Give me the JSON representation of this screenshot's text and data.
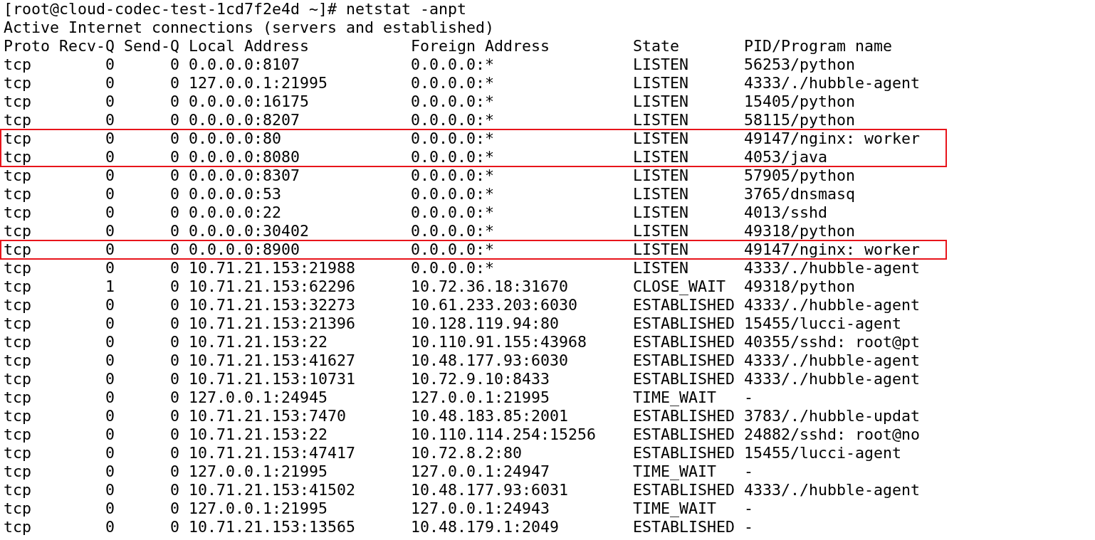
{
  "prompt": "[root@cloud-codec-test-1cd7f2e4d ~]# netstat -anpt",
  "summary": "Active Internet connections (servers and established)",
  "columns": [
    "Proto",
    "Recv-Q",
    "Send-Q",
    "Local Address",
    "Foreign Address",
    "State",
    "PID/Program name"
  ],
  "rows": [
    {
      "cells": [
        "tcp",
        "0",
        "0",
        "0.0.0.0:8107",
        "0.0.0.0:*",
        "LISTEN",
        "56253/python"
      ],
      "highlighted": false
    },
    {
      "cells": [
        "tcp",
        "0",
        "0",
        "127.0.0.1:21995",
        "0.0.0.0:*",
        "LISTEN",
        "4333/./hubble-agent"
      ],
      "highlighted": false
    },
    {
      "cells": [
        "tcp",
        "0",
        "0",
        "0.0.0.0:16175",
        "0.0.0.0:*",
        "LISTEN",
        "15405/python"
      ],
      "highlighted": false
    },
    {
      "cells": [
        "tcp",
        "0",
        "0",
        "0.0.0.0:8207",
        "0.0.0.0:*",
        "LISTEN",
        "58115/python"
      ],
      "highlighted": false
    },
    {
      "cells": [
        "tcp",
        "0",
        "0",
        "0.0.0.0:80",
        "0.0.0.0:*",
        "LISTEN",
        "49147/nginx: worker"
      ],
      "highlighted": true
    },
    {
      "cells": [
        "tcp",
        "0",
        "0",
        "0.0.0.0:8080",
        "0.0.0.0:*",
        "LISTEN",
        "4053/java"
      ],
      "highlighted": true
    },
    {
      "cells": [
        "tcp",
        "0",
        "0",
        "0.0.0.0:8307",
        "0.0.0.0:*",
        "LISTEN",
        "57905/python"
      ],
      "highlighted": false
    },
    {
      "cells": [
        "tcp",
        "0",
        "0",
        "0.0.0.0:53",
        "0.0.0.0:*",
        "LISTEN",
        "3765/dnsmasq"
      ],
      "highlighted": false
    },
    {
      "cells": [
        "tcp",
        "0",
        "0",
        "0.0.0.0:22",
        "0.0.0.0:*",
        "LISTEN",
        "4013/sshd"
      ],
      "highlighted": false
    },
    {
      "cells": [
        "tcp",
        "0",
        "0",
        "0.0.0.0:30402",
        "0.0.0.0:*",
        "LISTEN",
        "49318/python"
      ],
      "highlighted": false
    },
    {
      "cells": [
        "tcp",
        "0",
        "0",
        "0.0.0.0:8900",
        "0.0.0.0:*",
        "LISTEN",
        "49147/nginx: worker"
      ],
      "highlighted": true
    },
    {
      "cells": [
        "tcp",
        "0",
        "0",
        "10.71.21.153:21988",
        "0.0.0.0:*",
        "LISTEN",
        "4333/./hubble-agent"
      ],
      "highlighted": false
    },
    {
      "cells": [
        "tcp",
        "1",
        "0",
        "10.71.21.153:62296",
        "10.72.36.18:31670",
        "CLOSE_WAIT",
        "49318/python"
      ],
      "highlighted": false
    },
    {
      "cells": [
        "tcp",
        "0",
        "0",
        "10.71.21.153:32273",
        "10.61.233.203:6030",
        "ESTABLISHED",
        "4333/./hubble-agent"
      ],
      "highlighted": false
    },
    {
      "cells": [
        "tcp",
        "0",
        "0",
        "10.71.21.153:21396",
        "10.128.119.94:80",
        "ESTABLISHED",
        "15455/lucci-agent"
      ],
      "highlighted": false
    },
    {
      "cells": [
        "tcp",
        "0",
        "0",
        "10.71.21.153:22",
        "10.110.91.155:43968",
        "ESTABLISHED",
        "40355/sshd: root@pt"
      ],
      "highlighted": false
    },
    {
      "cells": [
        "tcp",
        "0",
        "0",
        "10.71.21.153:41627",
        "10.48.177.93:6030",
        "ESTABLISHED",
        "4333/./hubble-agent"
      ],
      "highlighted": false
    },
    {
      "cells": [
        "tcp",
        "0",
        "0",
        "10.71.21.153:10731",
        "10.72.9.10:8433",
        "ESTABLISHED",
        "4333/./hubble-agent"
      ],
      "highlighted": false
    },
    {
      "cells": [
        "tcp",
        "0",
        "0",
        "127.0.0.1:24945",
        "127.0.0.1:21995",
        "TIME_WAIT",
        "-"
      ],
      "highlighted": false
    },
    {
      "cells": [
        "tcp",
        "0",
        "0",
        "10.71.21.153:7470",
        "10.48.183.85:2001",
        "ESTABLISHED",
        "3783/./hubble-updat"
      ],
      "highlighted": false
    },
    {
      "cells": [
        "tcp",
        "0",
        "0",
        "10.71.21.153:22",
        "10.110.114.254:15256",
        "ESTABLISHED",
        "24882/sshd: root@no"
      ],
      "highlighted": false
    },
    {
      "cells": [
        "tcp",
        "0",
        "0",
        "10.71.21.153:47417",
        "10.72.8.2:80",
        "ESTABLISHED",
        "15455/lucci-agent"
      ],
      "highlighted": false
    },
    {
      "cells": [
        "tcp",
        "0",
        "0",
        "127.0.0.1:21995",
        "127.0.0.1:24947",
        "TIME_WAIT",
        "-"
      ],
      "highlighted": false
    },
    {
      "cells": [
        "tcp",
        "0",
        "0",
        "10.71.21.153:41502",
        "10.48.177.93:6031",
        "ESTABLISHED",
        "4333/./hubble-agent"
      ],
      "highlighted": false
    },
    {
      "cells": [
        "tcp",
        "0",
        "0",
        "127.0.0.1:21995",
        "127.0.0.1:24943",
        "TIME_WAIT",
        "-"
      ],
      "highlighted": false
    },
    {
      "cells": [
        "tcp",
        "0",
        "0",
        "10.71.21.153:13565",
        "10.48.179.1:2049",
        "ESTABLISHED",
        "-"
      ],
      "highlighted": false
    }
  ]
}
